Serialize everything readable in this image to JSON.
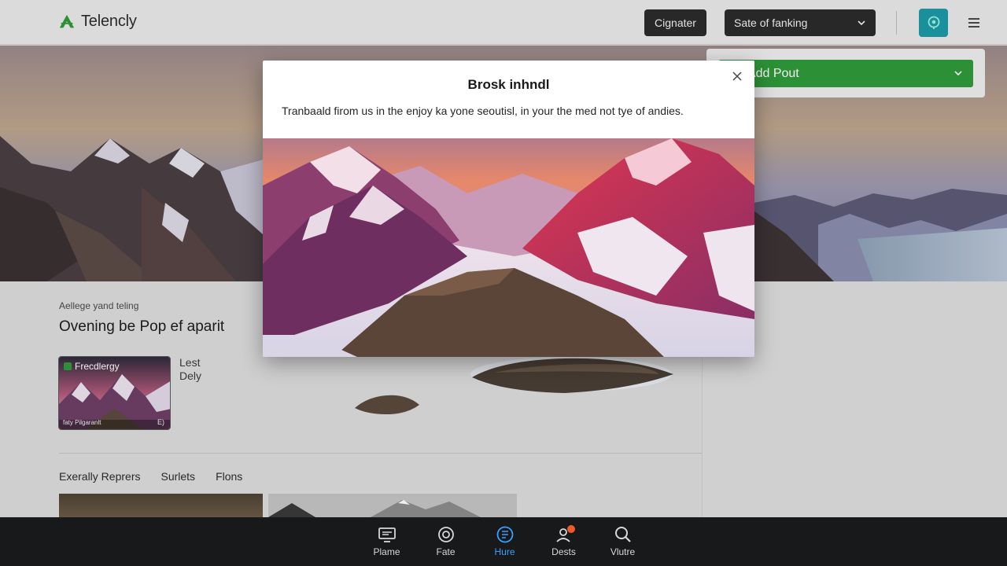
{
  "app": {
    "name": "Telencly"
  },
  "header": {
    "signup_label": "Cignater",
    "sort_label": "Sate of fanking",
    "add_post_label": "ut  Add Pout"
  },
  "main": {
    "eyebrow": "Aellege yand teling",
    "title": "Ovening be Pop ef aparit",
    "card": {
      "title": "Frecdlergy",
      "foot_left": "faty Pilgaranlt",
      "foot_right": "E)"
    },
    "card_meta": [
      "Lest",
      "Dely"
    ],
    "tabs": [
      "Exerally Reprers",
      "Surlets",
      "Flons"
    ]
  },
  "modal": {
    "title": "Brosk inhndl",
    "body": "Tranbaald firom us in the enjoy ka yone seoutisl, in your the med not tye of andies."
  },
  "bottom_nav": {
    "items": [
      {
        "label": "Plame",
        "icon": "monitor-icon"
      },
      {
        "label": "Fate",
        "icon": "target-icon"
      },
      {
        "label": "Hure",
        "icon": "list-circle-icon",
        "active": true
      },
      {
        "label": "Dests",
        "icon": "user-badge-icon",
        "badge": true
      },
      {
        "label": "Vlutre",
        "icon": "search-icon"
      }
    ]
  },
  "colors": {
    "accent_green": "#2f9a3a",
    "accent_teal": "#1b9aa6",
    "nav_active": "#3aa0ff",
    "badge": "#f05a28"
  }
}
